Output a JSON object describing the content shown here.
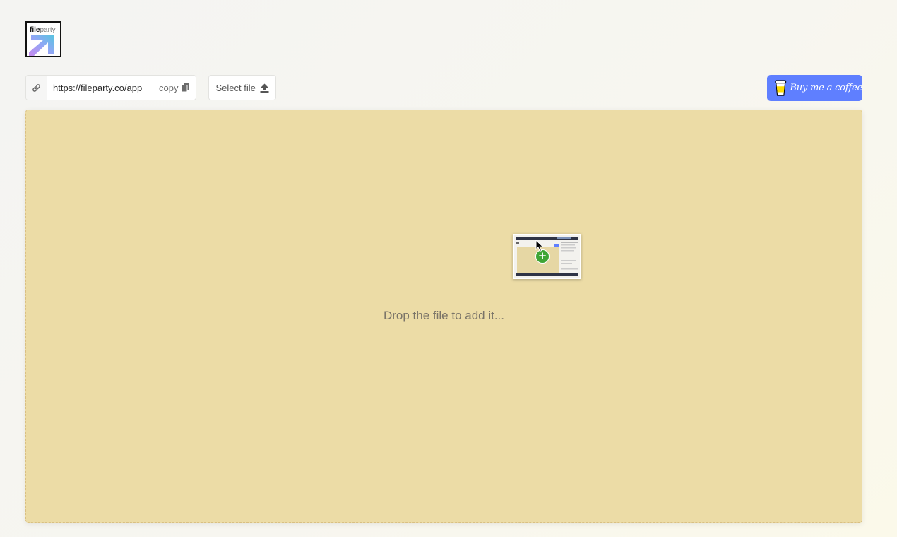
{
  "logo": {
    "text_bold": "file",
    "text_light": "party"
  },
  "toolbar": {
    "link_icon": "link-icon",
    "url_value": "https://fileparty.co/app",
    "copy_label": "copy",
    "copy_icon": "copy-icon",
    "select_label": "Select file",
    "select_icon": "upload-icon"
  },
  "support": {
    "coffee_label": "Buy me a coffee",
    "coffee_icon": "coffee-cup-icon"
  },
  "dropzone": {
    "message": "Drop the file to add it...",
    "drag_preview_icon": "file-thumbnail-icon",
    "drag_badge_icon": "plus-icon"
  },
  "colors": {
    "dropzone_bg": "#ecdca6",
    "coffee_button": "#5f7fff",
    "plus_badge": "#3fa535"
  }
}
